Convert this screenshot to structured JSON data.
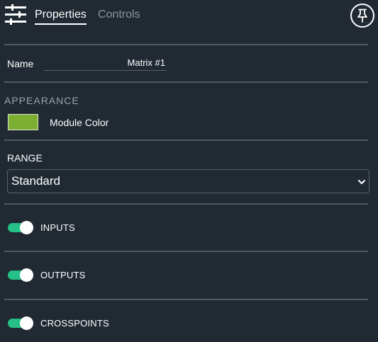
{
  "header": {
    "menu_icon": "tune-sliders-icon",
    "tabs": [
      {
        "label": "Properties",
        "active": true
      },
      {
        "label": "Controls",
        "active": false
      }
    ],
    "pin_icon": "pin-icon"
  },
  "name": {
    "label": "Name",
    "value": "Matrix #1"
  },
  "appearance": {
    "title": "APPEARANCE",
    "module_color_label": "Module Color",
    "module_color": "#7caf31"
  },
  "range": {
    "title": "RANGE",
    "selected": "Standard"
  },
  "toggles": [
    {
      "label": "INPUTS",
      "on": true
    },
    {
      "label": "OUTPUTS",
      "on": true
    },
    {
      "label": "CROSSPOINTS",
      "on": true
    }
  ],
  "colors": {
    "background": "#212a33",
    "toggle_on": "#25c088",
    "divider": "#515a62"
  }
}
